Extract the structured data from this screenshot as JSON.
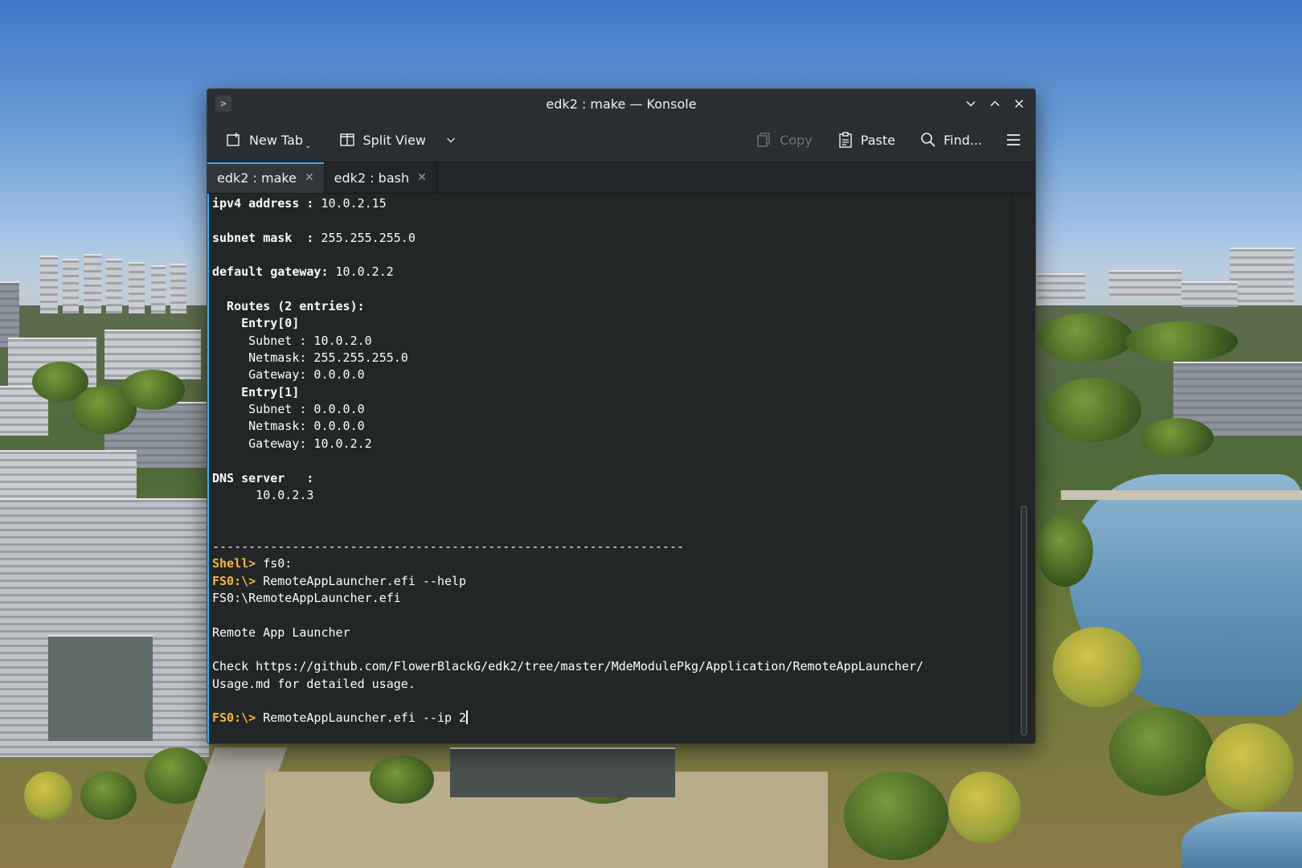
{
  "window": {
    "title": "edk2 : make — Konsole",
    "app_icon": "terminal-icon"
  },
  "toolbar": {
    "new_tab": "New Tab",
    "split_view": "Split View",
    "copy": "Copy",
    "paste": "Paste",
    "find": "Find..."
  },
  "tabs": [
    {
      "label": "edk2 : make",
      "active": true
    },
    {
      "label": "edk2 : bash",
      "active": false
    }
  ],
  "terminal": {
    "lines": [
      {
        "segments": [
          {
            "text": "ipv4 address : ",
            "style": "bold"
          },
          {
            "text": "10.0.2.15"
          }
        ]
      },
      {
        "segments": []
      },
      {
        "segments": [
          {
            "text": "subnet mask  : ",
            "style": "bold"
          },
          {
            "text": "255.255.255.0"
          }
        ]
      },
      {
        "segments": []
      },
      {
        "segments": [
          {
            "text": "default gateway: ",
            "style": "bold"
          },
          {
            "text": "10.0.2.2"
          }
        ]
      },
      {
        "segments": []
      },
      {
        "segments": [
          {
            "text": "  Routes (2 entries):",
            "style": "bold"
          }
        ]
      },
      {
        "segments": [
          {
            "text": "    Entry[0]",
            "style": "bold"
          }
        ]
      },
      {
        "segments": [
          {
            "text": "     Subnet : 10.0.2.0"
          }
        ]
      },
      {
        "segments": [
          {
            "text": "     Netmask: 255.255.255.0"
          }
        ]
      },
      {
        "segments": [
          {
            "text": "     Gateway: 0.0.0.0"
          }
        ]
      },
      {
        "segments": [
          {
            "text": "    Entry[1]",
            "style": "bold"
          }
        ]
      },
      {
        "segments": [
          {
            "text": "     Subnet : 0.0.0.0"
          }
        ]
      },
      {
        "segments": [
          {
            "text": "     Netmask: 0.0.0.0"
          }
        ]
      },
      {
        "segments": [
          {
            "text": "     Gateway: 10.0.2.2"
          }
        ]
      },
      {
        "segments": []
      },
      {
        "segments": [
          {
            "text": "DNS server   :",
            "style": "bold"
          }
        ]
      },
      {
        "segments": [
          {
            "text": "      10.0.2.3"
          }
        ]
      },
      {
        "segments": []
      },
      {
        "segments": []
      },
      {
        "segments": [
          {
            "text": "-----------------------------------------------------------------"
          }
        ]
      },
      {
        "segments": [
          {
            "text": "Shell> ",
            "style": "prompt"
          },
          {
            "text": "fs0:"
          }
        ]
      },
      {
        "segments": [
          {
            "text": "FS0:\\> ",
            "style": "prompt"
          },
          {
            "text": "RemoteAppLauncher.efi --help"
          }
        ]
      },
      {
        "segments": [
          {
            "text": "FS0:\\RemoteAppLauncher.efi"
          }
        ]
      },
      {
        "segments": []
      },
      {
        "segments": [
          {
            "text": "Remote App Launcher"
          }
        ]
      },
      {
        "segments": []
      },
      {
        "segments": [
          {
            "text": "Check https://github.com/FlowerBlackG/edk2/tree/master/MdeModulePkg/Application/RemoteAppLauncher/"
          }
        ]
      },
      {
        "segments": [
          {
            "text": "Usage.md for detailed usage."
          }
        ]
      },
      {
        "segments": []
      },
      {
        "segments": [
          {
            "text": "FS0:\\> ",
            "style": "prompt"
          },
          {
            "text": "RemoteAppLauncher.efi --ip 2"
          }
        ],
        "cursor": true
      }
    ]
  },
  "colors": {
    "accent": "#3daee9",
    "prompt": "#f5b73c",
    "terminal_bg": "#232627",
    "terminal_fg": "#fcfcfc"
  }
}
